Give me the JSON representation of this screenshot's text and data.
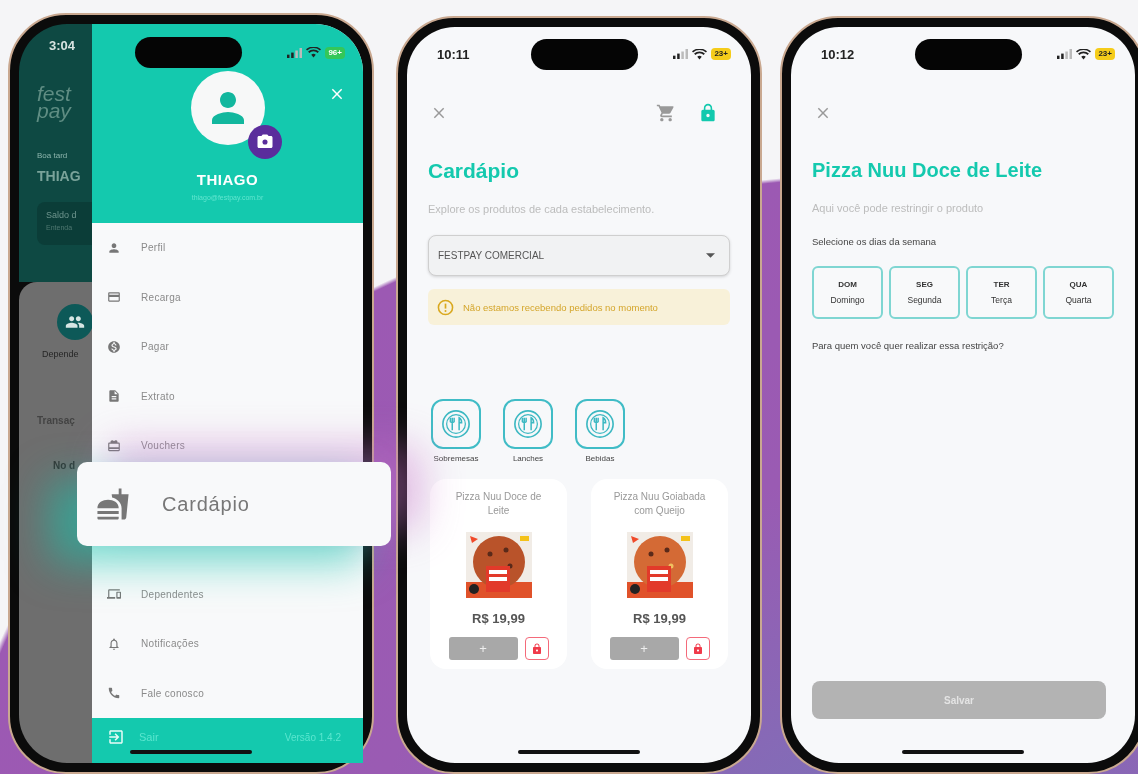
{
  "screens": [
    {
      "kind": "menu",
      "status_bar": {
        "time": "3:04",
        "battery": "96+",
        "low_power_mode": false
      },
      "background": {
        "logo": [
          "fest",
          "pay"
        ],
        "greeting": "Boa tard",
        "name": "THIAG",
        "balance_title": "Saldo d",
        "balance_hint": "Entenda",
        "shortcut": "Depende",
        "section": "Transaç",
        "empty_text": "No d"
      },
      "drawer": {
        "name": "THIAGO",
        "email": "thiago@festpay.com.br",
        "items": [
          {
            "label": "Perfil",
            "highlighted": false
          },
          {
            "label": "Recarga",
            "highlighted": false
          },
          {
            "label": "Pagar",
            "highlighted": false
          },
          {
            "label": "Extrato",
            "highlighted": false
          },
          {
            "label": "Vouchers",
            "highlighted": false
          },
          {
            "label": "Cardápio",
            "highlighted": true
          },
          {
            "label": "Dependentes",
            "highlighted": false
          },
          {
            "label": "Notificações",
            "highlighted": false
          },
          {
            "label": "Fale conosco",
            "highlighted": false
          }
        ],
        "footer": {
          "logout": "Sair",
          "version": "Versão 1.4.2"
        }
      }
    },
    {
      "kind": "catalog",
      "status_bar": {
        "time": "10:11",
        "battery": "23+",
        "low_power_mode": true
      },
      "title": "Cardápio",
      "subtitle": "Explore os produtos de cada estabelecimento.",
      "establishment": "FESTPAY COMERCIAL",
      "notice": "Não estamos recebendo pedidos no momento",
      "categories": [
        {
          "label": "Sobremesas"
        },
        {
          "label": "Lanches"
        },
        {
          "label": "Bebidas"
        }
      ],
      "products": [
        {
          "name": "Pizza Nuu Doce de Leite",
          "price": "R$ 19,99",
          "add_label": "+"
        },
        {
          "name": "Pizza Nuu Goiabada com Queijo",
          "price": "R$ 19,99",
          "add_label": "+"
        }
      ]
    },
    {
      "kind": "restriction",
      "status_bar": {
        "time": "10:12",
        "battery": "23+",
        "low_power_mode": true
      },
      "title": "Pizza Nuu Doce de Leite",
      "subtitle": "Aqui você pode restringir o produto",
      "days_label": "Selecione os dias da semana",
      "days": [
        {
          "short": "DOM",
          "long": "Domingo",
          "selected": false
        },
        {
          "short": "SEG",
          "long": "Segunda",
          "selected": false
        },
        {
          "short": "TER",
          "long": "Terça",
          "selected": false
        },
        {
          "short": "QUA",
          "long": "Quarta",
          "selected": false
        }
      ],
      "question": "Para quem você quer realizar essa restrição?",
      "save": {
        "label": "Salvar",
        "disabled": true
      }
    }
  ]
}
